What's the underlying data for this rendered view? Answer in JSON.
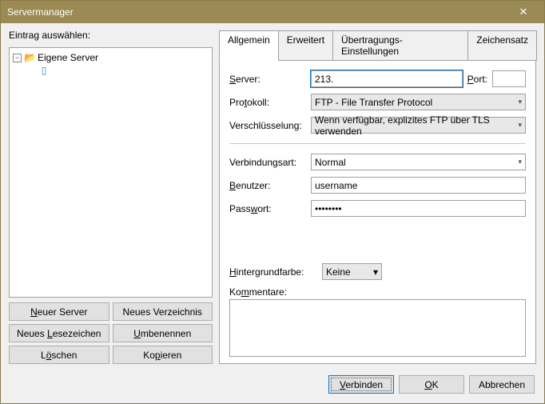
{
  "window": {
    "title": "Servermanager"
  },
  "left": {
    "select_label": "Eintrag auswählen:",
    "root_label": "Eigene Server",
    "buttons": {
      "new_server": "Neuer Server",
      "new_folder": "Neues Verzeichnis",
      "new_bookmark": "Neues Lesezeichen",
      "rename": "Umbenennen",
      "delete": "Löschen",
      "copy": "Kopieren"
    }
  },
  "tabs": {
    "general": "Allgemein",
    "advanced": "Erweitert",
    "transfer": "Übertragungs-Einstellungen",
    "charset": "Zeichensatz"
  },
  "form": {
    "server_label": "Server:",
    "server_value": "213.",
    "port_label": "Port:",
    "port_value": "",
    "protocol_label": "Protokoll:",
    "protocol_value": "FTP - File Transfer Protocol",
    "encryption_label": "Verschlüsselung:",
    "encryption_value": "Wenn verfügbar, explizites FTP über TLS verwenden",
    "logon_label": "Verbindungsart:",
    "logon_value": "Normal",
    "user_label": "Benutzer:",
    "user_value": "username",
    "pass_label": "Passwort:",
    "pass_value": "••••••••",
    "bgcolor_label": "Hintergrundfarbe:",
    "bgcolor_value": "Keine",
    "comments_label": "Kommentare:",
    "comments_value": ""
  },
  "footer": {
    "connect": "Verbinden",
    "ok": "OK",
    "cancel": "Abbrechen"
  }
}
